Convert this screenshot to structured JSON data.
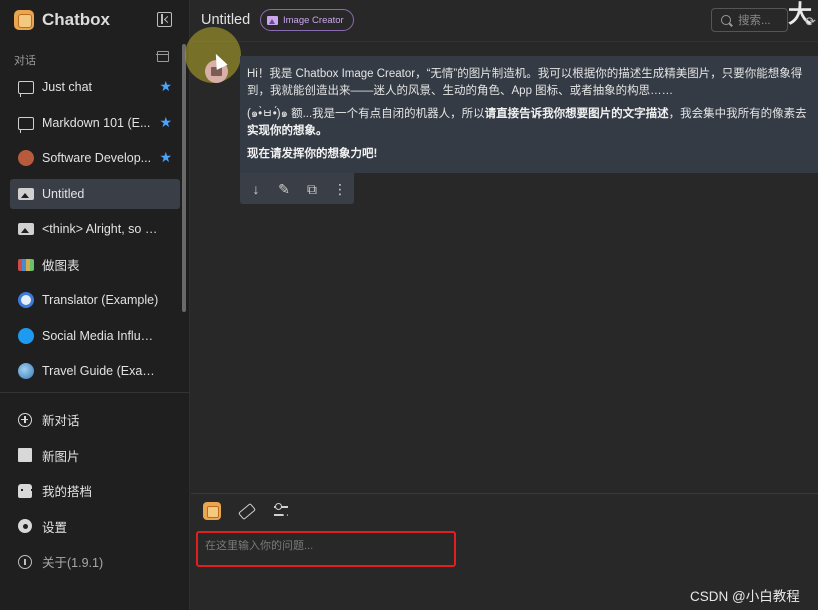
{
  "sidebar": {
    "brand": "Chatbox",
    "section_label": "对话",
    "items": [
      {
        "label": "Just chat",
        "icon": "chat-icon",
        "starred": true
      },
      {
        "label": "Markdown 101 (E...",
        "icon": "chat-icon",
        "starred": true
      },
      {
        "label": "Software Develop...",
        "icon": "developer-avatar-icon",
        "starred": true
      },
      {
        "label": "Untitled",
        "icon": "image-icon",
        "starred": false,
        "active": true
      },
      {
        "label": "<think> Alright, so I ne...",
        "icon": "image-icon",
        "starred": false
      },
      {
        "label": "做图表",
        "icon": "chart-avatar-icon",
        "starred": false
      },
      {
        "label": "Translator (Example)",
        "icon": "translator-avatar-icon",
        "starred": false
      },
      {
        "label": "Social Media Influence...",
        "icon": "twitter-avatar-icon",
        "starred": false
      },
      {
        "label": "Travel Guide (Example)",
        "icon": "globe-avatar-icon",
        "starred": false
      }
    ],
    "bottom": {
      "new_chat": "新对话",
      "new_image": "新图片",
      "my_partners": "我的搭档",
      "settings": "设置",
      "about": "关于(1.9.1)"
    }
  },
  "header": {
    "title": "Untitled",
    "badge": "Image Creator",
    "search_placeholder": "搜索...",
    "corner_glyph": "大"
  },
  "message": {
    "line1": "Hi！我是 Chatbox Image Creator，“无情”的图片制造机。我可以根据你的描述生成精美图片，只要你能想象得",
    "line2": "到，我就能创造出来——迷人的风景、生动的角色、App 图标、或者抽象的构思……",
    "line3_prefix": "(๑•̀ㅂ•́)๑ 额...我是一个有点自闭的机器人，所以",
    "line3_bold": "请直接告诉我你想要图片的文字描述",
    "line3_suffix": "，我会集中我所有的像素去",
    "line4": "实现你的想象。",
    "line5": "现在请发挥你的想象力吧!"
  },
  "input": {
    "placeholder": "在这里输入你的问题..."
  },
  "watermark": "CSDN @小白教程",
  "colors": {
    "accent_star": "#4aa3ff",
    "badge_purple": "#c9a6ee",
    "highlight_box": "#e01f1f",
    "message_bg": "#353b45"
  }
}
